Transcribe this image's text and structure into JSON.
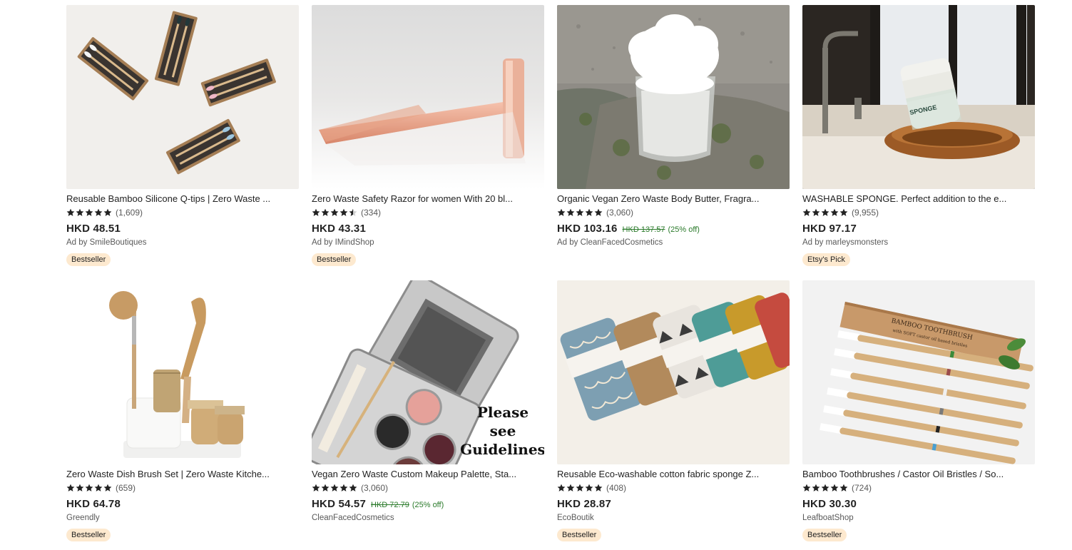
{
  "products": [
    {
      "title": "Reusable Bamboo Silicone Q-tips | Zero Waste ...",
      "reviews": "(1,609)",
      "rating": 5,
      "price": "HKD 48.51",
      "old_price": "",
      "discount": "",
      "shop": "Ad by SmileBoutiques",
      "badge": "Bestseller",
      "icon": "q-tips-image"
    },
    {
      "title": "Zero Waste Safety Razor for women With 20 bl...",
      "reviews": "(334)",
      "rating": 4.5,
      "price": "HKD 43.31",
      "old_price": "",
      "discount": "",
      "shop": "Ad by IMindShop",
      "badge": "Bestseller",
      "icon": "razor-image"
    },
    {
      "title": "Organic Vegan Zero Waste Body Butter, Fragra...",
      "reviews": "(3,060)",
      "rating": 5,
      "price": "HKD 103.16",
      "old_price": "HKD 137.57",
      "discount": "(25% off)",
      "shop": "Ad by CleanFacedCosmetics",
      "badge": "",
      "icon": "body-butter-image"
    },
    {
      "title": "WASHABLE SPONGE. Perfect addition to the e...",
      "reviews": "(9,955)",
      "rating": 5,
      "price": "HKD 97.17",
      "old_price": "",
      "discount": "",
      "shop": "Ad by marleysmonsters",
      "badge": "Etsy's Pick",
      "icon": "sponge-image"
    },
    {
      "title": "Zero Waste Dish Brush Set | Zero Waste Kitche...",
      "reviews": "(659)",
      "rating": 5,
      "price": "HKD 64.78",
      "old_price": "",
      "discount": "",
      "shop": "Greendly",
      "badge": "Bestseller",
      "icon": "dish-brush-image"
    },
    {
      "title": "Vegan Zero Waste Custom Makeup Palette, Sta...",
      "reviews": "(3,060)",
      "rating": 5,
      "price": "HKD 54.57",
      "old_price": "HKD 72.79",
      "discount": "(25% off)",
      "shop": "CleanFacedCosmetics",
      "badge": "",
      "icon": "makeup-palette-image",
      "image_text": [
        "Please",
        "see",
        "Guidelines"
      ]
    },
    {
      "title": "Reusable Eco-washable cotton fabric sponge Z...",
      "reviews": "(408)",
      "rating": 5,
      "price": "HKD 28.87",
      "old_price": "",
      "discount": "",
      "shop": "EcoBoutik",
      "badge": "Bestseller",
      "icon": "fabric-sponge-image"
    },
    {
      "title": "Bamboo Toothbrushes / Castor Oil Bristles / So...",
      "reviews": "(724)",
      "rating": 5,
      "price": "HKD 30.30",
      "old_price": "",
      "discount": "",
      "shop": "LeafboatShop",
      "badge": "Bestseller",
      "icon": "toothbrush-image",
      "image_text": [
        "BAMBOO TOOTHBRUSH",
        "with SOFT castor oil based bristles"
      ]
    }
  ],
  "colors": {
    "badge_bg": "#fde9cf",
    "sale_green": "#2a7a2a",
    "text": "#222222",
    "muted": "#595959"
  }
}
